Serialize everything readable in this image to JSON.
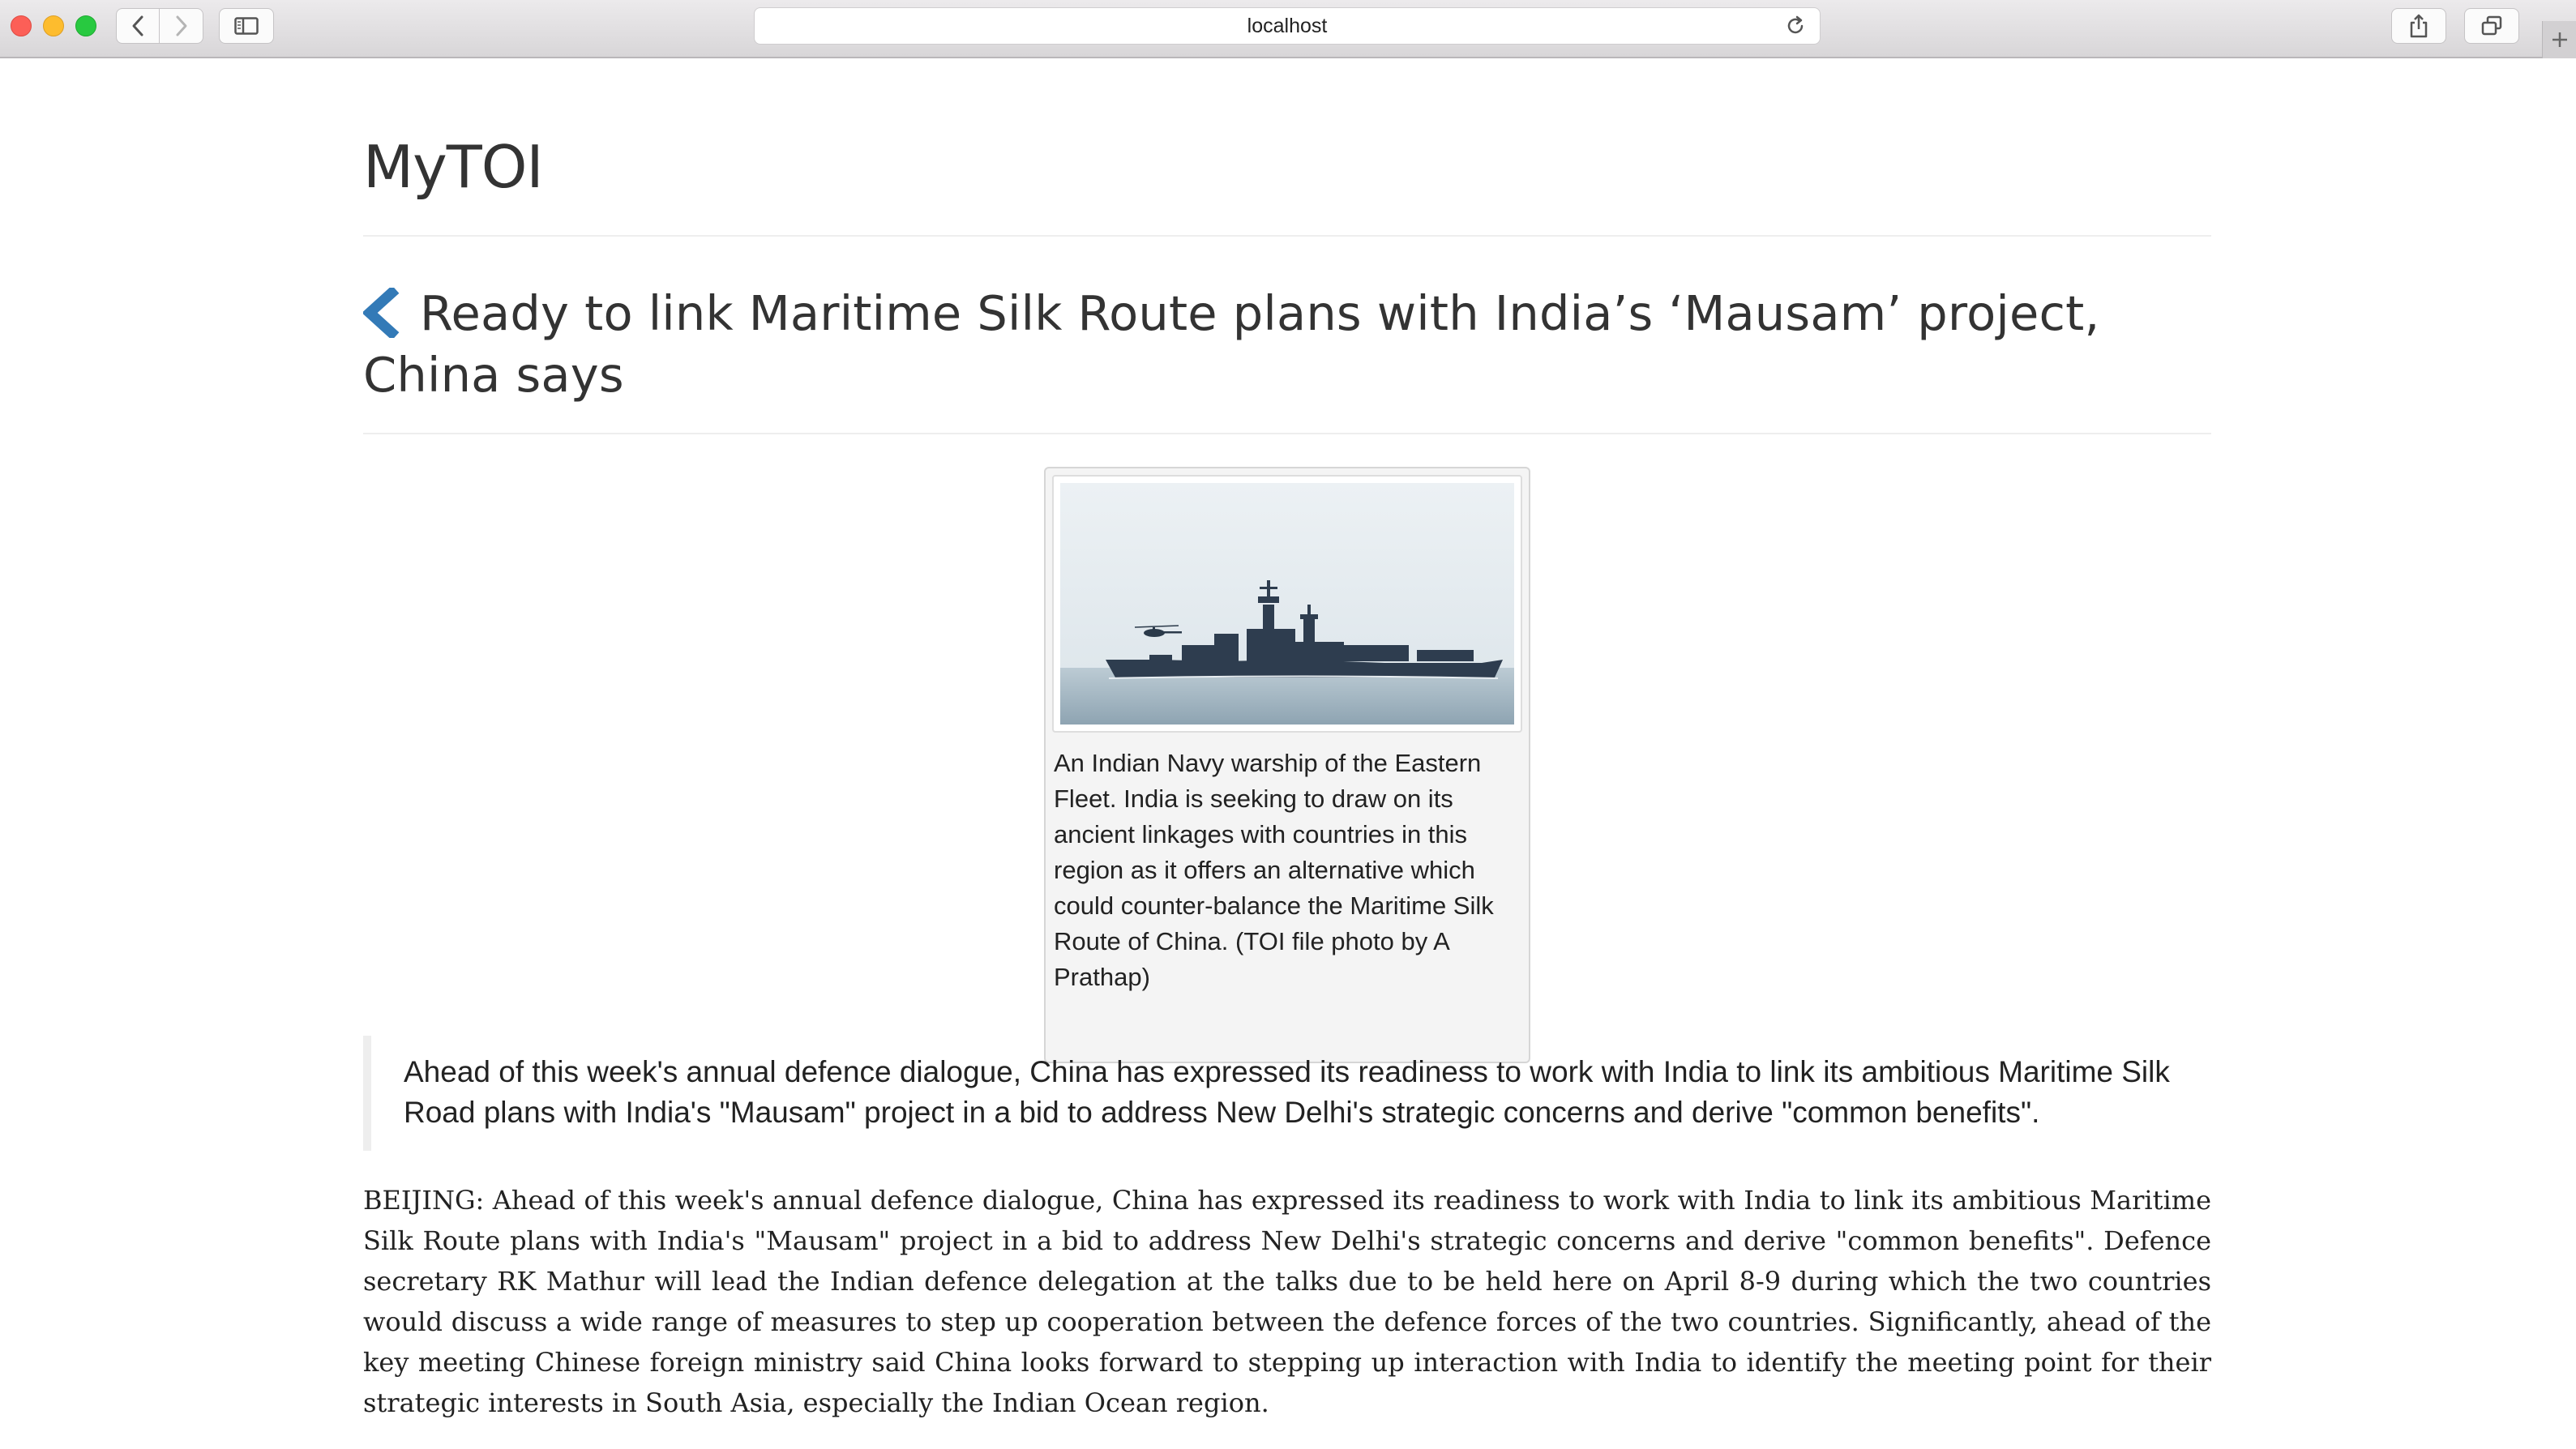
{
  "browser": {
    "url": "localhost",
    "icons": {
      "back": "chevron-left-icon",
      "forward": "chevron-right-icon",
      "sidebar": "sidebar-icon",
      "reload": "reload-icon",
      "share": "share-icon",
      "tabs": "tabs-overview-icon",
      "new_tab": "plus-icon"
    }
  },
  "site": {
    "title": "MyTOI"
  },
  "article": {
    "back_icon": "chevron-left-icon",
    "back_icon_color": "#337ab7",
    "headline": "Ready to link Maritime Silk Route plans with India’s ‘Mausam’ project, China says",
    "image_alt": "Indian Navy warship at sea with helicopter",
    "caption": "An Indian Navy warship of the Eastern Fleet. India is seeking to draw on its ancient linkages with countries in this region as it offers an alternative which could counter-balance the Maritime Silk Route of China. (TOI file photo by A Prathap)",
    "summary": "Ahead of this week's annual defence dialogue, China has expressed its readiness to work with India to link its ambitious Maritime Silk Road plans with India's \"Mausam\" project in a bid to address New Delhi's strategic concerns and derive \"common benefits\".",
    "body": "BEIJING: Ahead of this week's annual defence dialogue, China has expressed its readiness to work with India to link its ambitious Maritime Silk Route plans with India's \"Mausam\" project in a bid to address New Delhi's strategic concerns and derive \"common benefits\". Defence secretary RK Mathur will lead the Indian defence delegation at the talks due to be held here on April 8-9 during which the two countries would discuss a wide range of measures to step up cooperation between the defence forces of the two countries. Significantly, ahead of the key meeting Chinese foreign ministry said China looks forward to stepping up interaction with India to identify the meeting point for their strategic interests in South Asia, especially the Indian Ocean region."
  }
}
